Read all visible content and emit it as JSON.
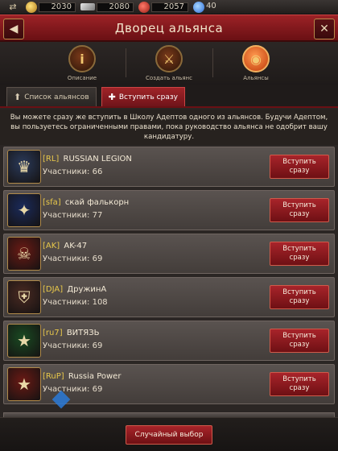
{
  "resources": {
    "gold": "2030",
    "silver": "2080",
    "food": "2057",
    "gems": "40"
  },
  "header": {
    "title": "Дворец альянса",
    "back_icon": "back-arrow-icon",
    "close_icon": "close-icon"
  },
  "nav": [
    {
      "label": "Описание",
      "icon": "info-icon"
    },
    {
      "label": "Создать альянс",
      "icon": "crossed-swords-icon"
    },
    {
      "label": "Альянсы",
      "icon": "globe-icon"
    }
  ],
  "tabs": [
    {
      "label": "Список альянсов"
    },
    {
      "label": "Вступить сразу"
    }
  ],
  "info_text": "Вы можете сразу же вступить в Школу Адептов одного из альянсов. Будучи Адептом, вы пользуетесь ограниченными правами, пока руководство альянса не одобрит вашу кандидатуру.",
  "alliances": [
    {
      "tag": "[RL]",
      "name": "RUSSIAN LEGION",
      "members": "Участники: 66",
      "button": "Вступить сразу",
      "emblem_color": "#2a3a5a",
      "emblem_icon": "eagle-icon"
    },
    {
      "tag": "[sfa]",
      "name": "скай фалькорн",
      "members": "Участники: 77",
      "button": "Вступить сразу",
      "emblem_color": "#1a2a5a",
      "emblem_icon": "bird-icon"
    },
    {
      "tag": "[AK]",
      "name": "AK-47",
      "members": "Участники: 69",
      "button": "Вступить сразу",
      "emblem_color": "#6a1a14",
      "emblem_icon": "skull-icon"
    },
    {
      "tag": "[DJA]",
      "name": "ДружинА",
      "members": "Участники: 108",
      "button": "Вступить сразу",
      "emblem_color": "#4a2a22",
      "emblem_icon": "helmet-icon"
    },
    {
      "tag": "[ru7]",
      "name": "ВИТЯЗЬ",
      "members": "Участники: 69",
      "button": "Вступить сразу",
      "emblem_color": "#1a4a22",
      "emblem_icon": "star-icon"
    },
    {
      "tag": "[RuP]",
      "name": "Russia Power",
      "members": "Участники: 69",
      "button": "Вступить сразу",
      "emblem_color": "#6a1a14",
      "emblem_icon": "star-icon"
    }
  ],
  "footer": {
    "random_button": "Случайный выбор"
  }
}
